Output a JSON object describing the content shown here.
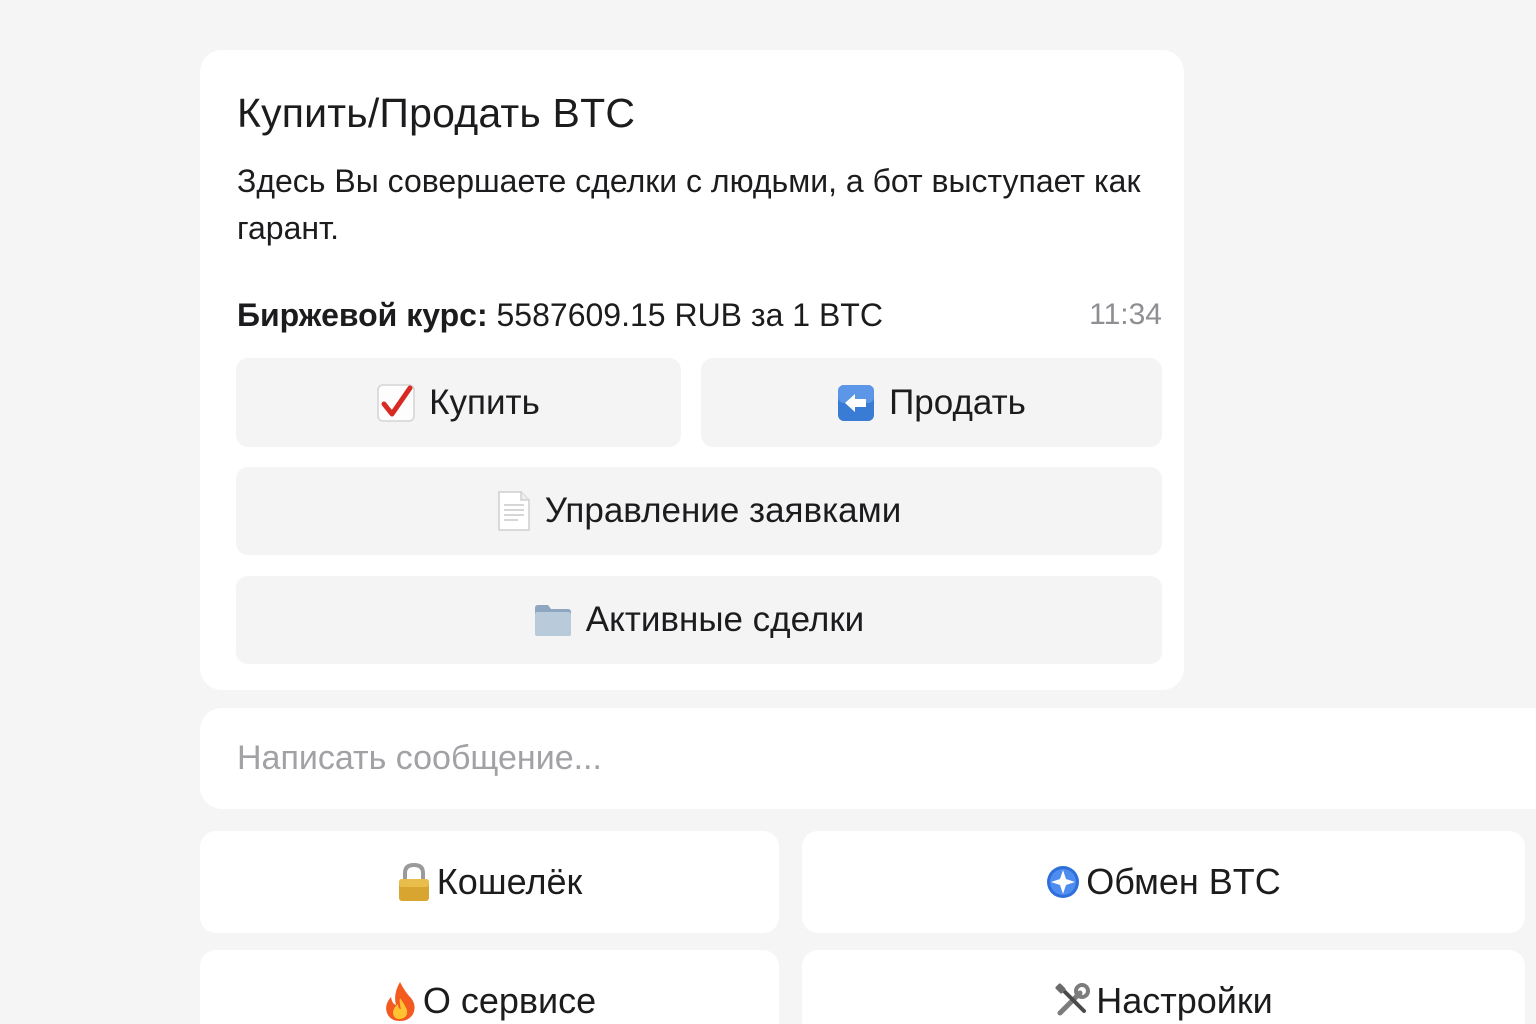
{
  "message": {
    "title": "Купить/Продать BTC",
    "body": "Здесь Вы совершаете сделки с людьми, а бот выступает как гарант.",
    "rate_label": "Биржевой курс:",
    "rate_value": "5587609.15 RUB за 1 BTC",
    "time": "11:34"
  },
  "inline_buttons": {
    "buy": {
      "label": "Купить",
      "icon": "red-check-icon"
    },
    "sell": {
      "label": "Продать",
      "icon": "left-arrow-icon"
    },
    "orders": {
      "label": "Управление заявками",
      "icon": "document-icon"
    },
    "deals": {
      "label": "Активные сделки",
      "icon": "folder-icon"
    }
  },
  "composer": {
    "placeholder": "Написать сообщение..."
  },
  "reply_keyboard": {
    "wallet": {
      "label": "Кошелёк",
      "icon": "lock-icon"
    },
    "exchange": {
      "label": "Обмен BTC",
      "icon": "compass-icon"
    },
    "about": {
      "label": "О сервисе",
      "icon": "fire-icon"
    },
    "settings": {
      "label": "Настройки",
      "icon": "tools-icon"
    }
  },
  "colors": {
    "background": "#f5f5f5",
    "surface": "#ffffff",
    "button": "#f4f4f4",
    "text": "#1c1c1e",
    "muted": "#8e8e93"
  }
}
